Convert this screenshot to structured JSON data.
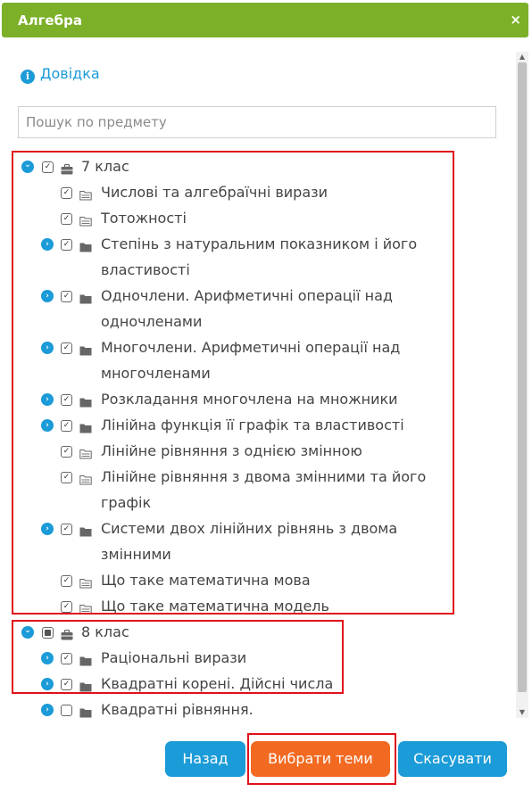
{
  "dialog": {
    "title": "Алгебра",
    "close_label": "×"
  },
  "help": {
    "icon": "info-icon",
    "label": "Довідка"
  },
  "search": {
    "placeholder": "Пошук по предмету"
  },
  "colors": {
    "header": "#7bb028",
    "accent": "#1b9bd7",
    "primary_button": "#f26a21",
    "highlight": "#e0101b"
  },
  "tree": {
    "grade7": {
      "label": "7 клас",
      "items": [
        {
          "label": "Числові та алгебраїчні вирази",
          "expandable": false,
          "checked": true
        },
        {
          "label": "Тотожності",
          "expandable": false,
          "checked": true
        },
        {
          "label": "Степінь з натуральним показником і його",
          "label2": "властивості",
          "expandable": true,
          "checked": true
        },
        {
          "label": "Одночлени. Арифметичні операції над",
          "label2": "одночленами",
          "expandable": true,
          "checked": true
        },
        {
          "label": "Многочлени. Арифметичні операції над",
          "label2": "многочленами",
          "expandable": true,
          "checked": true
        },
        {
          "label": "Розкладання многочлена на множники",
          "expandable": true,
          "checked": true
        },
        {
          "label": "Лінійна функція її графік та властивості",
          "expandable": true,
          "checked": true
        },
        {
          "label": "Лінійне рівняння з однією змінною",
          "expandable": false,
          "checked": true
        },
        {
          "label": "Лінійне рівняння з двома змінними та його",
          "label2": "графік",
          "expandable": false,
          "checked": true
        },
        {
          "label": "Системи двох лінійних рівнянь з двома",
          "label2": "змінними",
          "expandable": true,
          "checked": true
        },
        {
          "label": "Що таке математична мова",
          "expandable": false,
          "checked": true
        },
        {
          "label": "Що таке математична модель",
          "expandable": false,
          "checked": true
        }
      ]
    },
    "grade8": {
      "label": "8 клас",
      "items": [
        {
          "label": "Раціональні вирази",
          "expandable": true,
          "checked": true
        },
        {
          "label": "Квадратні корені. Дійсні числа",
          "expandable": true,
          "checked": true
        },
        {
          "label": "Квадратні рівняння.",
          "expandable": true,
          "checked": false
        }
      ]
    }
  },
  "buttons": {
    "back": "Назад",
    "select": "Вибрати теми",
    "cancel": "Скасувати"
  }
}
